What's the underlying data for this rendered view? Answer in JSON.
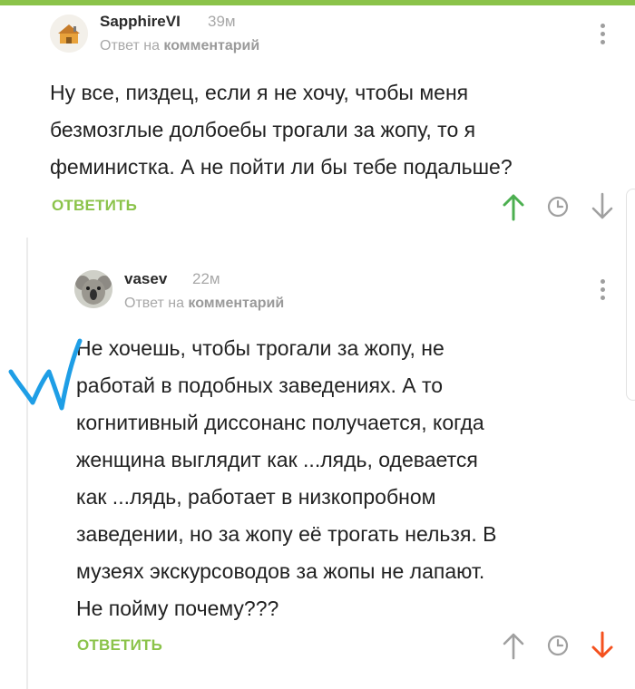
{
  "colors": {
    "accent": "#8bc34a",
    "upvote_active": "#4caf50",
    "downvote_active": "#f4511e",
    "icon_gray": "#a0a0a0",
    "annotation": "#1e9ee6"
  },
  "comments": [
    {
      "username": "SapphireVI",
      "time": "39м",
      "reply_prefix": "Ответ на",
      "reply_target": "комментарий",
      "body_lines": [
        "Ну все, пиздец, если я не хочу, чтобы меня",
        "безмозглые долбоебы трогали за жопу, то я",
        "феминистка. А не пойти ли бы тебе подальше?"
      ],
      "reply_label": "ОТВЕТИТЬ",
      "vote": "up",
      "icons": [
        "upvote-icon",
        "clock-icon",
        "downvote-icon",
        "more-vertical-icon"
      ]
    },
    {
      "username": "vasev",
      "time": "22м",
      "reply_prefix": "Ответ на",
      "reply_target": "комментарий",
      "body_lines": [
        "Не хочешь, чтобы трогали за жопу, не",
        "работай в подобных заведениях. А то",
        "когнитивный диссонанс получается, когда",
        "женщина выглядит как ...лядь, одевается",
        "как ...лядь, работает в низкопробном",
        "заведении, но за жопу её трогать нельзя. В",
        "музеях экскурсоводов за жопы не лапают.",
        "Не пойму почему???"
      ],
      "reply_label": "ОТВЕТИТЬ",
      "vote": "down",
      "icons": [
        "upvote-icon",
        "clock-icon",
        "downvote-icon",
        "more-vertical-icon"
      ]
    }
  ]
}
